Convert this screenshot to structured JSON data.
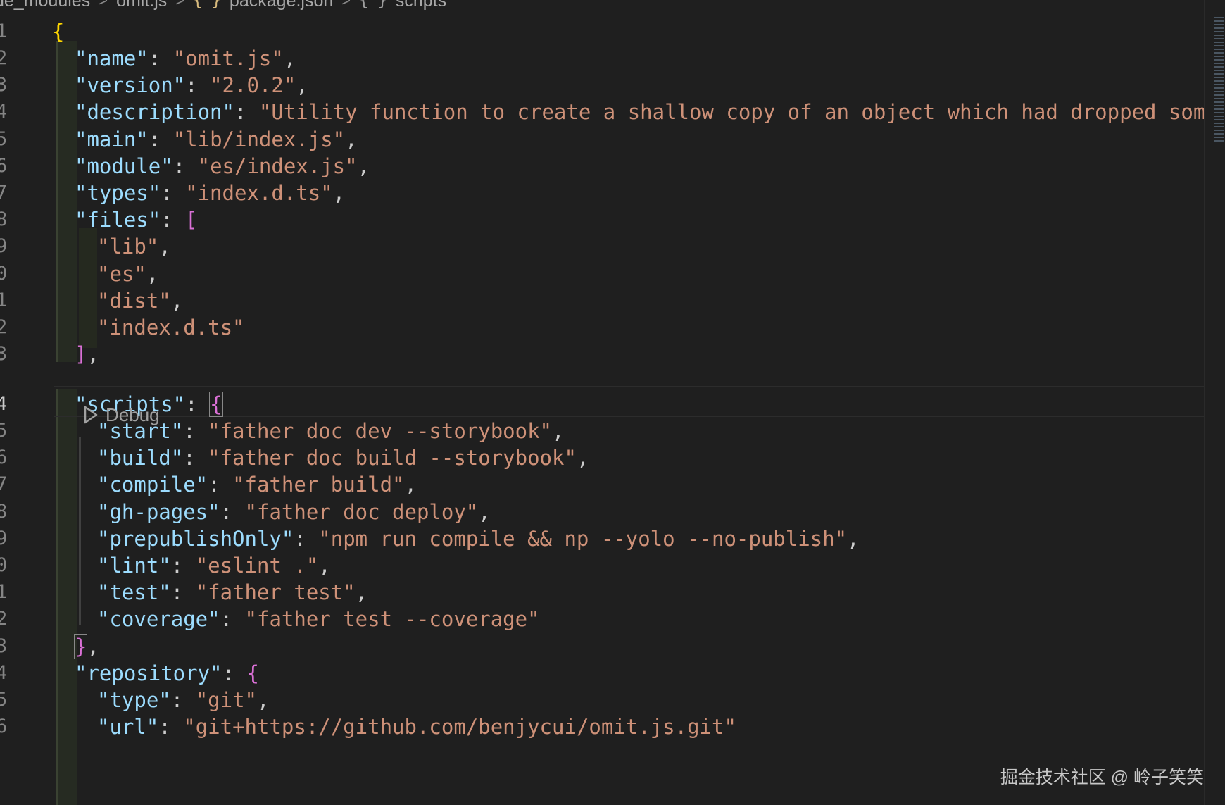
{
  "breadcrumb": {
    "items": [
      "de_modules",
      "omit.js",
      "package.json",
      "scripts"
    ],
    "separator": ">",
    "brace_icon": "{ }"
  },
  "codelens": {
    "label": "Debug"
  },
  "lines": [
    {
      "num": "1",
      "indent": 0,
      "tokens": [
        [
          "b1",
          "{"
        ]
      ]
    },
    {
      "num": "2",
      "indent": 1,
      "tokens": [
        [
          "key",
          "\"name\""
        ],
        [
          "p",
          ": "
        ],
        [
          "s",
          "\"omit.js\""
        ],
        [
          "p",
          ","
        ]
      ]
    },
    {
      "num": "3",
      "indent": 1,
      "tokens": [
        [
          "key",
          "\"version\""
        ],
        [
          "p",
          ": "
        ],
        [
          "s",
          "\"2.0.2\""
        ],
        [
          "p",
          ","
        ]
      ]
    },
    {
      "num": "4",
      "indent": 1,
      "tokens": [
        [
          "key",
          "\"description\""
        ],
        [
          "p",
          ": "
        ],
        [
          "s",
          "\"Utility function to create a shallow copy of an object which had dropped some"
        ]
      ]
    },
    {
      "num": "5",
      "indent": 1,
      "tokens": [
        [
          "key",
          "\"main\""
        ],
        [
          "p",
          ": "
        ],
        [
          "s",
          "\"lib/index.js\""
        ],
        [
          "p",
          ","
        ]
      ]
    },
    {
      "num": "6",
      "indent": 1,
      "tokens": [
        [
          "key",
          "\"module\""
        ],
        [
          "p",
          ": "
        ],
        [
          "s",
          "\"es/index.js\""
        ],
        [
          "p",
          ","
        ]
      ]
    },
    {
      "num": "7",
      "indent": 1,
      "tokens": [
        [
          "key",
          "\"types\""
        ],
        [
          "p",
          ": "
        ],
        [
          "s",
          "\"index.d.ts\""
        ],
        [
          "p",
          ","
        ]
      ]
    },
    {
      "num": "8",
      "indent": 1,
      "tokens": [
        [
          "key",
          "\"files\""
        ],
        [
          "p",
          ": "
        ],
        [
          "b2",
          "["
        ]
      ]
    },
    {
      "num": "9",
      "indent": 2,
      "tokens": [
        [
          "s",
          "\"lib\""
        ],
        [
          "p",
          ","
        ]
      ]
    },
    {
      "num": "0",
      "indent": 2,
      "tokens": [
        [
          "s",
          "\"es\""
        ],
        [
          "p",
          ","
        ]
      ]
    },
    {
      "num": "1",
      "indent": 2,
      "tokens": [
        [
          "s",
          "\"dist\""
        ],
        [
          "p",
          ","
        ]
      ]
    },
    {
      "num": "2",
      "indent": 2,
      "tokens": [
        [
          "s",
          "\"index.d.ts\""
        ]
      ]
    },
    {
      "num": "3",
      "indent": 1,
      "tokens": [
        [
          "b2",
          "]"
        ],
        [
          "p",
          ","
        ]
      ]
    },
    {
      "num": "4",
      "indent": 1,
      "active": true,
      "tokens": [
        [
          "key",
          "\"scripts\""
        ],
        [
          "p",
          ": "
        ],
        [
          "b2 bracketbox",
          "{"
        ]
      ]
    },
    {
      "num": "5",
      "indent": 2,
      "tokens": [
        [
          "key",
          "\"start\""
        ],
        [
          "p",
          ": "
        ],
        [
          "s",
          "\"father doc dev --storybook\""
        ],
        [
          "p",
          ","
        ]
      ]
    },
    {
      "num": "6",
      "indent": 2,
      "tokens": [
        [
          "key",
          "\"build\""
        ],
        [
          "p",
          ": "
        ],
        [
          "s",
          "\"father doc build --storybook\""
        ],
        [
          "p",
          ","
        ]
      ]
    },
    {
      "num": "7",
      "indent": 2,
      "tokens": [
        [
          "key",
          "\"compile\""
        ],
        [
          "p",
          ": "
        ],
        [
          "s",
          "\"father build\""
        ],
        [
          "p",
          ","
        ]
      ]
    },
    {
      "num": "8",
      "indent": 2,
      "tokens": [
        [
          "key",
          "\"gh-pages\""
        ],
        [
          "p",
          ": "
        ],
        [
          "s",
          "\"father doc deploy\""
        ],
        [
          "p",
          ","
        ]
      ]
    },
    {
      "num": "9",
      "indent": 2,
      "tokens": [
        [
          "key",
          "\"prepublishOnly\""
        ],
        [
          "p",
          ": "
        ],
        [
          "s",
          "\"npm run compile && np --yolo --no-publish\""
        ],
        [
          "p",
          ","
        ]
      ]
    },
    {
      "num": "0",
      "indent": 2,
      "tokens": [
        [
          "key",
          "\"lint\""
        ],
        [
          "p",
          ": "
        ],
        [
          "s",
          "\"eslint .\""
        ],
        [
          "p",
          ","
        ]
      ]
    },
    {
      "num": "1",
      "indent": 2,
      "tokens": [
        [
          "key",
          "\"test\""
        ],
        [
          "p",
          ": "
        ],
        [
          "s",
          "\"father test\""
        ],
        [
          "p",
          ","
        ]
      ]
    },
    {
      "num": "2",
      "indent": 2,
      "tokens": [
        [
          "key",
          "\"coverage\""
        ],
        [
          "p",
          ": "
        ],
        [
          "s",
          "\"father test --coverage\""
        ]
      ]
    },
    {
      "num": "3",
      "indent": 1,
      "tokens": [
        [
          "b2 bracketbox",
          "}"
        ],
        [
          "p",
          ","
        ]
      ]
    },
    {
      "num": "4",
      "indent": 1,
      "tokens": [
        [
          "key",
          "\"repository\""
        ],
        [
          "p",
          ": "
        ],
        [
          "b2",
          "{"
        ]
      ]
    },
    {
      "num": "5",
      "indent": 2,
      "tokens": [
        [
          "key",
          "\"type\""
        ],
        [
          "p",
          ": "
        ],
        [
          "s",
          "\"git\""
        ],
        [
          "p",
          ","
        ]
      ]
    },
    {
      "num": "6",
      "indent": 2,
      "tokens": [
        [
          "key",
          "\"url\""
        ],
        [
          "p",
          ": "
        ],
        [
          "s",
          "\"git+https://github.com/benjycui/omit.js.git\""
        ]
      ]
    }
  ],
  "watermark": "掘金技术社区 @ 岭子笑笑",
  "colors": {
    "background": "#1f1f1f",
    "key": "#9cdcfe",
    "string": "#ce9178",
    "bracket_level1": "#ffd700",
    "bracket_level2": "#da70d6",
    "line_number": "#858585"
  }
}
